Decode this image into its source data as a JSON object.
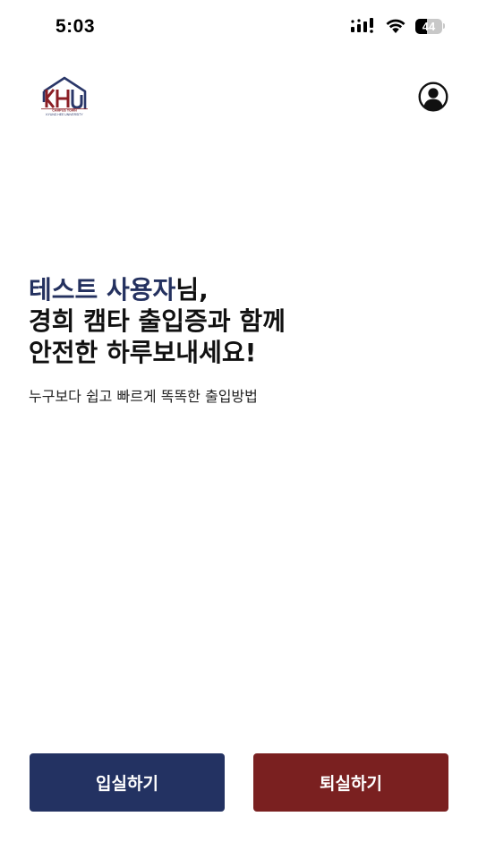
{
  "status_bar": {
    "time": "5:03",
    "battery_level": "44",
    "battery_fraction": 0.44,
    "icons": [
      "cellular-signal-icon",
      "wifi-icon",
      "battery-icon"
    ]
  },
  "header": {
    "logo": {
      "letters": "KHU",
      "line1": "CAMPUS TOWN",
      "line2": "KYUNG HEE UNIVERSITY"
    },
    "profile_icon": "user-circle-icon"
  },
  "greeting": {
    "user_name": "테스트 사용자",
    "suffix": "님,",
    "line2": "경희 캠타 출입증과 함께",
    "line3": "안전한 하루보내세요!",
    "subtitle": "누구보다 쉽고 빠르게 똑똑한 출입방법"
  },
  "actions": {
    "check_in_label": "입실하기",
    "check_out_label": "퇴실하기"
  },
  "colors": {
    "navy": "#233262",
    "maroon": "#7a2020",
    "name_highlight": "#24315f"
  }
}
